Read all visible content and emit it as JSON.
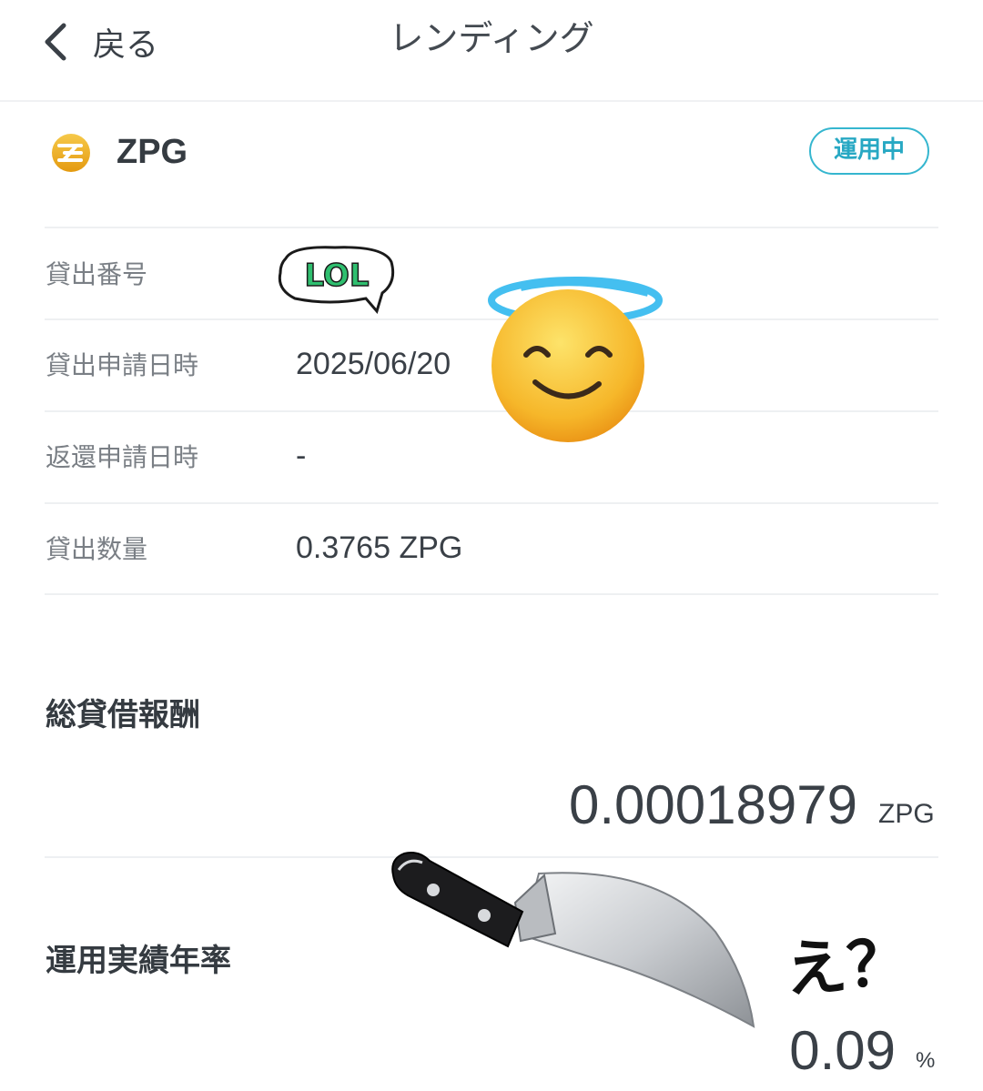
{
  "header": {
    "back_label": "戻る",
    "title": "レンディング"
  },
  "coin": {
    "name": "ZPG",
    "status": "運用中",
    "brand_color": "#f2b51f",
    "status_color": "#35b6cf"
  },
  "details": [
    {
      "label": "貸出番号",
      "value": ""
    },
    {
      "label": "貸出申請日時",
      "value": "2025/06/20"
    },
    {
      "label": "返還申請日時",
      "value": "-"
    },
    {
      "label": "貸出数量",
      "value": "0.3765 ZPG"
    }
  ],
  "reward": {
    "title": "総貸借報酬",
    "value": "0.00018979",
    "unit": "ZPG"
  },
  "annual_rate": {
    "title": "運用実績年率",
    "value": "0.09",
    "unit": "%"
  },
  "stickers": {
    "lol_text": "LOL",
    "handwritten": "え？",
    "icons": [
      "halo-smile-emoji",
      "kitchen-knife"
    ]
  }
}
